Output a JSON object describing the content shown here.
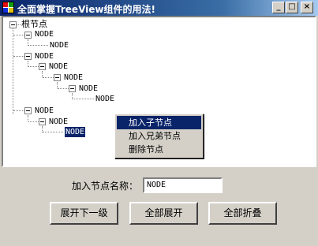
{
  "window": {
    "title": "全面掌握TreeView组件的用法!"
  },
  "titlebar": {
    "min_glyph": "_",
    "max_glyph": "□",
    "close_glyph": "×"
  },
  "tree": {
    "root": "根节点",
    "nodes": [
      {
        "label": "NODE"
      },
      {
        "label": "NODE"
      },
      {
        "label": "NODE"
      },
      {
        "label": "NODE"
      },
      {
        "label": "NODE"
      },
      {
        "label": "NODE"
      },
      {
        "label": "NODE"
      },
      {
        "label": "NODE"
      },
      {
        "label": "NODE"
      },
      {
        "label": "NODE"
      }
    ]
  },
  "context_menu": {
    "items": [
      {
        "label": "加入子节点"
      },
      {
        "label": "加入兄弟节点"
      },
      {
        "label": "删除节点"
      }
    ]
  },
  "form": {
    "name_label": "加入节点名称：",
    "name_value": "NODE"
  },
  "buttons": {
    "expand_next": "展开下一级",
    "expand_all": "全部展开",
    "collapse_all": "全部折叠"
  }
}
